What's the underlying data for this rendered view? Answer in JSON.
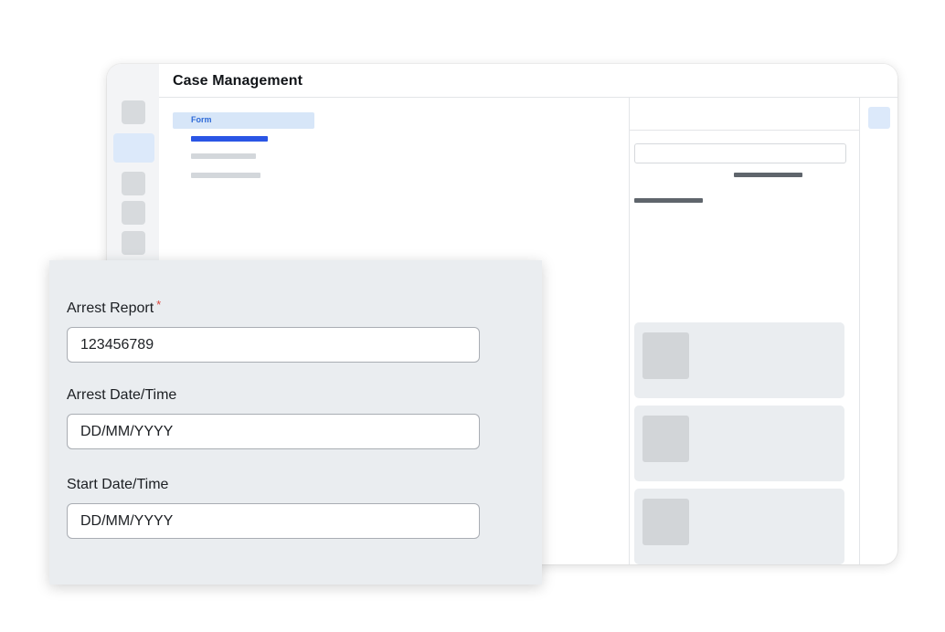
{
  "app": {
    "title": "Case Management"
  },
  "tree": {
    "form_label": "Form"
  },
  "form": {
    "fields": [
      {
        "label": "Arrest Report",
        "required_mark": "*",
        "value": "123456789"
      },
      {
        "label": "Arrest Date/Time",
        "value": "DD/MM/YYYY"
      },
      {
        "label": "Start Date/Time",
        "value": "DD/MM/YYYY"
      }
    ]
  },
  "colors": {
    "accent": "#2a55e5",
    "selection": "#d7e6f8",
    "required": "#d9453c",
    "panel": "#eaedf0"
  },
  "icons": [
    "rail-icon-placeholder",
    "card-thumbnail-placeholder"
  ]
}
